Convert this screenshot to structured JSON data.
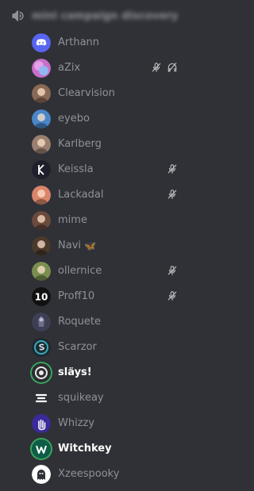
{
  "channel": {
    "name": "mini campaign discovery",
    "icon": "speaker-icon"
  },
  "users": [
    {
      "name": "Arthann",
      "avatar_color": "#5865f2",
      "avatar_icon": "discord-logo-icon",
      "muted": false,
      "deafened": false,
      "speaking": false,
      "active": false
    },
    {
      "name": "aZix",
      "avatar_color": "#c86fc9",
      "avatar_icon": "pastel-avatar-icon",
      "muted": true,
      "deafened": true,
      "speaking": false,
      "active": false
    },
    {
      "name": "Clearvision",
      "avatar_color": "#8a6a55",
      "avatar_icon": "person-avatar-icon",
      "muted": false,
      "deafened": false,
      "speaking": false,
      "active": false
    },
    {
      "name": "eyebo",
      "avatar_color": "#4a86c8",
      "avatar_icon": "person-avatar-icon",
      "muted": false,
      "deafened": false,
      "speaking": false,
      "active": false
    },
    {
      "name": "Karlberg",
      "avatar_color": "#9a8070",
      "avatar_icon": "person-avatar-icon",
      "muted": false,
      "deafened": false,
      "speaking": false,
      "active": false
    },
    {
      "name": "Keissla",
      "avatar_color": "#1e1f2b",
      "avatar_icon": "k-logo-icon",
      "muted": true,
      "deafened": false,
      "speaking": false,
      "active": false
    },
    {
      "name": "Lackadal",
      "avatar_color": "#d9866b",
      "avatar_icon": "person-avatar-icon",
      "muted": true,
      "deafened": false,
      "speaking": false,
      "active": false
    },
    {
      "name": "mime",
      "avatar_color": "#6b4a3e",
      "avatar_icon": "person-avatar-icon",
      "muted": false,
      "deafened": false,
      "speaking": false,
      "active": false
    },
    {
      "name": "Navi",
      "avatar_color": "#4a3a2c",
      "avatar_icon": "person-avatar-icon",
      "emoji": "🦋",
      "muted": false,
      "deafened": false,
      "speaking": false,
      "active": false
    },
    {
      "name": "ollernice",
      "avatar_color": "#7a8f4f",
      "avatar_icon": "person-avatar-icon",
      "muted": true,
      "deafened": false,
      "speaking": false,
      "active": false
    },
    {
      "name": "Proff10",
      "avatar_color": "#111111",
      "avatar_icon": "text-10-avatar-icon",
      "avatar_text": "10",
      "muted": true,
      "deafened": false,
      "speaking": false,
      "active": false
    },
    {
      "name": "Roquete",
      "avatar_color": "#3d3f55",
      "avatar_icon": "character-avatar-icon",
      "muted": false,
      "deafened": false,
      "speaking": false,
      "active": false
    },
    {
      "name": "Scarzor",
      "avatar_color": "#1c2a30",
      "avatar_icon": "s-emblem-icon",
      "muted": false,
      "deafened": false,
      "speaking": false,
      "active": false
    },
    {
      "name": "släys!",
      "avatar_color": "#2b2d31",
      "avatar_icon": "swirl-avatar-icon",
      "muted": false,
      "deafened": false,
      "speaking": true,
      "active": true
    },
    {
      "name": "squikeay",
      "avatar_color": "#2f3136",
      "avatar_icon": "stripes-logo-icon",
      "muted": false,
      "deafened": false,
      "speaking": false,
      "active": false
    },
    {
      "name": "Whizzy",
      "avatar_color": "#3b2a9a",
      "avatar_icon": "hand-logo-icon",
      "muted": false,
      "deafened": false,
      "speaking": false,
      "active": false
    },
    {
      "name": "Witchkey",
      "avatar_color": "#0e5e47",
      "avatar_icon": "w-logo-icon",
      "muted": false,
      "deafened": false,
      "speaking": true,
      "active": true
    },
    {
      "name": "Xzeespooky",
      "avatar_color": "#ffffff",
      "avatar_icon": "ghost-avatar-icon",
      "muted": false,
      "deafened": false,
      "speaking": false,
      "active": false
    }
  ],
  "colors": {
    "background": "#2f3136",
    "text_muted": "#8e9297",
    "text_active": "#ffffff",
    "speaking_ring": "#3ba55d",
    "status_icon": "#b9bbbe"
  }
}
